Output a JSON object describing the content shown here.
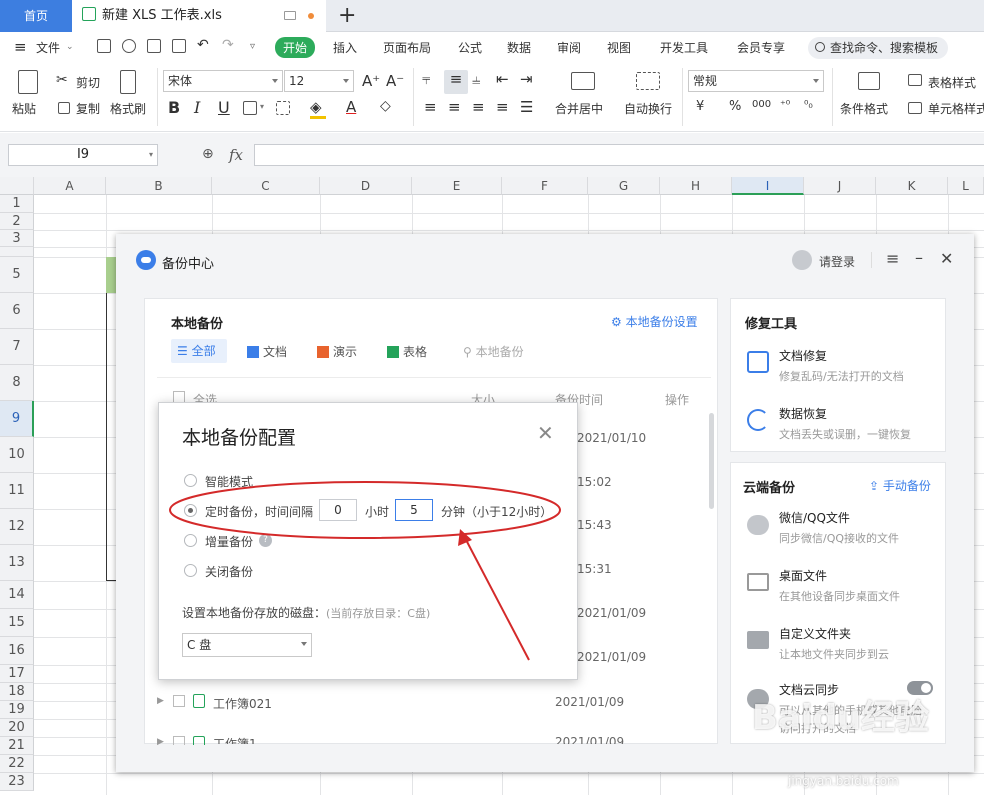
{
  "tabs": {
    "home": "首页",
    "file": "新建 XLS 工作表.xls"
  },
  "menu": {
    "file": "文件",
    "items": [
      "开始",
      "插入",
      "页面布局",
      "公式",
      "数据",
      "审阅",
      "视图",
      "开发工具",
      "会员专享"
    ],
    "search": "查找命令、搜索模板"
  },
  "ribbon": {
    "paste": "粘贴",
    "cut": "剪切",
    "copy": "复制",
    "format_painter": "格式刷",
    "font": "宋体",
    "font_size": "12",
    "merge": "合并居中",
    "wrap": "自动换行",
    "number_format": "常规",
    "cond_format": "条件格式",
    "table_style": "表格样式",
    "cell_style": "单元格样式",
    "bold": "B",
    "italic": "I",
    "underline": "U",
    "font_grow": "A⁺",
    "font_shrink": "A⁻",
    "currency": "¥",
    "percent": "%",
    "thousands": "000"
  },
  "formula_bar": {
    "name_box": "I9",
    "fx": "fx"
  },
  "columns": [
    "A",
    "B",
    "C",
    "D",
    "E",
    "F",
    "G",
    "H",
    "I",
    "J",
    "K",
    "L"
  ],
  "rows": [
    "1",
    "2",
    "3",
    "5",
    "6",
    "7",
    "8",
    "9",
    "10",
    "11",
    "12",
    "13",
    "14",
    "15",
    "16",
    "17",
    "18",
    "19",
    "20",
    "21",
    "22",
    "23"
  ],
  "backup": {
    "title": "备份中心",
    "login": "请登录",
    "local": {
      "title": "本地备份",
      "settings": "本地备份设置",
      "filters": [
        "全部",
        "文档",
        "演示",
        "表格"
      ],
      "search_placeholder": "本地备份",
      "columns": {
        "select_all": "全选",
        "size": "大小",
        "time": "备份时间",
        "action": "操作"
      },
      "times": [
        "2021/01/10",
        "15:02",
        "15:43",
        "15:31",
        "2021/01/09",
        "2021/01/09"
      ],
      "rows": [
        {
          "name": "工作簿021",
          "time": "2021/01/09"
        },
        {
          "name": "工作簿1",
          "time": "2021/01/09"
        }
      ]
    },
    "repair": {
      "title": "修复工具",
      "items": [
        {
          "title": "文档修复",
          "sub": "修复乱码/无法打开的文档"
        },
        {
          "title": "数据恢复",
          "sub": "文档丢失或误删，一键恢复"
        }
      ]
    },
    "cloud": {
      "title": "云端备份",
      "manual": "手动备份",
      "items": [
        {
          "title": "微信/QQ文件",
          "sub": "同步微信/QQ接收的文件"
        },
        {
          "title": "桌面文件",
          "sub": "在其他设备同步桌面文件"
        },
        {
          "title": "自定义文件夹",
          "sub": "让本地文件夹同步到云"
        },
        {
          "title": "文档云同步",
          "sub": "可以从其他的手机或其他电脑",
          "sub2": "访问打开的文档"
        }
      ]
    }
  },
  "dialog": {
    "title": "本地备份配置",
    "options": [
      "智能模式",
      "定时备份，时间间隔",
      "增量备份",
      "关闭备份"
    ],
    "hours_value": "0",
    "hours_label": "小时",
    "minutes_value": "5",
    "minutes_label": "分钟（小于12小时）",
    "disk_label": "设置本地备份存放的磁盘：",
    "disk_hint": "(当前存放目录：C盘)",
    "disk_value": "C 盘"
  },
  "watermark": {
    "brand": "Baidu经验",
    "url": "jingyan.baidu.com"
  }
}
